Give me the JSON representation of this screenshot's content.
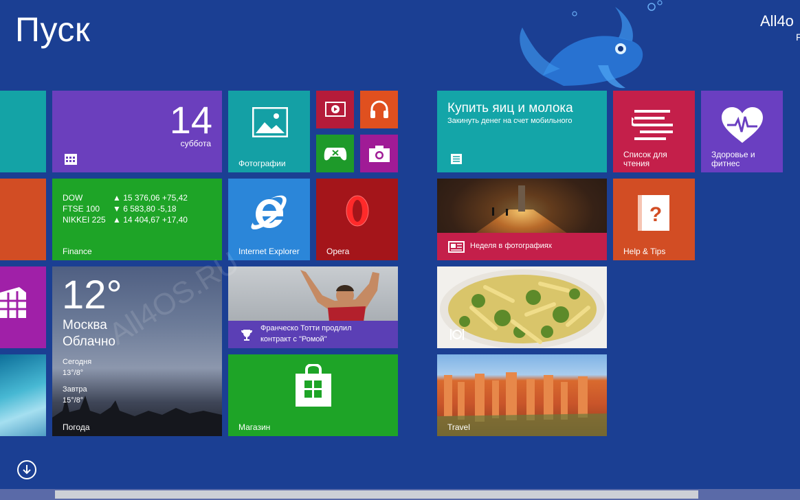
{
  "screen": {
    "title": "Пуск"
  },
  "account": {
    "name": "All4o",
    "sub": "F"
  },
  "tiles": {
    "calendar": {
      "day": "14",
      "weekday": "суббота"
    },
    "photos": {
      "label": "Фотографии"
    },
    "finance": {
      "label": "Finance",
      "rows": [
        {
          "name": "DOW",
          "value": "▲ 15 376,06 +75,42"
        },
        {
          "name": "FTSE 100",
          "value": "▼ 6 583,80 -5,18"
        },
        {
          "name": "NIKKEI 225",
          "value": "▲ 14 404,67 +17,40"
        }
      ]
    },
    "ie": {
      "label": "Internet Explorer"
    },
    "opera": {
      "label": "Opera"
    },
    "weather": {
      "temp": "12°",
      "city": "Москва",
      "condition": "Облачно",
      "today_label": "Сегодня",
      "today_value": "13°/8°",
      "tomorrow_label": "Завтра",
      "tomorrow_value": "15°/8°",
      "label": "Погода"
    },
    "sport": {
      "headline1": "Франческо Тотти продлил",
      "headline2": "контракт с \"Ромой\""
    },
    "store": {
      "label": "Магазин"
    },
    "reminder": {
      "title": "Купить яиц и молока",
      "subtitle": "Закинуть денег на счет мобильного"
    },
    "reading": {
      "label1": "Список для",
      "label2": "чтения"
    },
    "health": {
      "label1": "Здоровье и",
      "label2": "фитнес"
    },
    "news": {
      "label": "Неделя в фотографиях"
    },
    "help": {
      "label": "Help & Tips"
    },
    "travel": {
      "label": "Travel"
    }
  },
  "watermark": "All4OS.RU",
  "colors": {
    "background": "#1b3f93",
    "calendar": "#6b3fbd",
    "photos": "#14a0a5",
    "finance": "#1ea427",
    "ie": "#2b86d9",
    "opera": "#b51b1b",
    "sport": "#5b3fb5",
    "store": "#1ea427",
    "reminder": "#14a5a8",
    "reading": "#c41f4a",
    "health": "#6a3fc1",
    "help": "#d24d24",
    "news_strip": "#c41f4a"
  }
}
